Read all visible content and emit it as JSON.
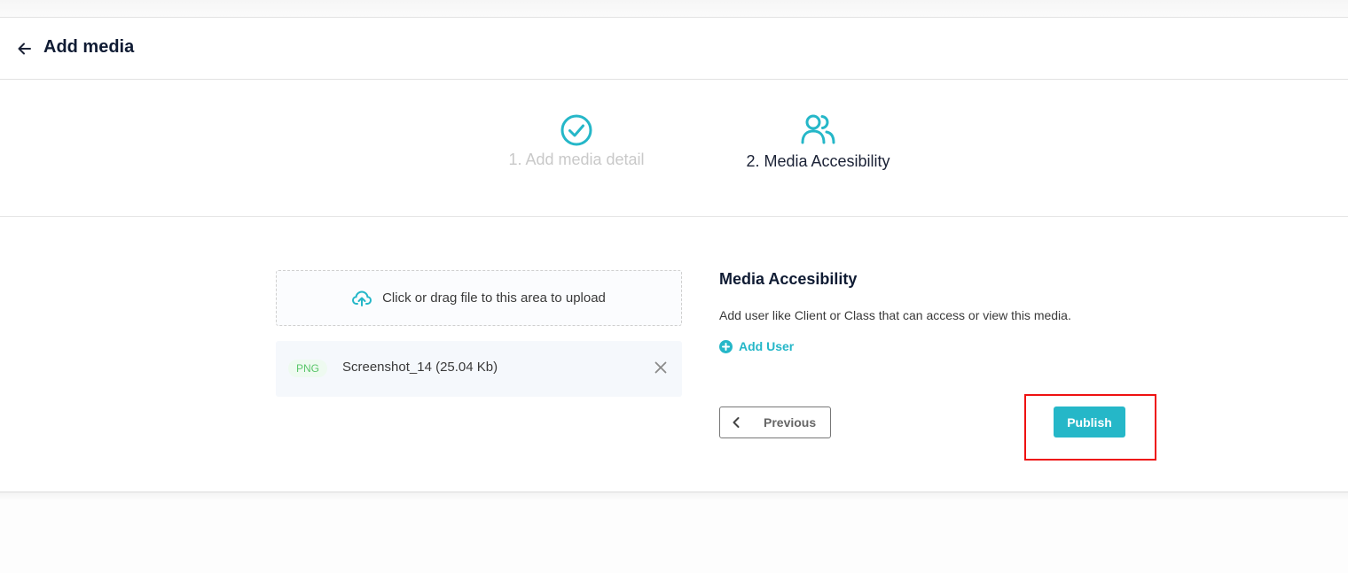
{
  "header": {
    "title": "Add media",
    "back_icon": "arrow-left-icon"
  },
  "steps": [
    {
      "label": "1. Add media detail",
      "icon": "check-circle-icon",
      "state": "completed"
    },
    {
      "label": "2. Media Accesibility",
      "icon": "users-icon",
      "state": "active"
    }
  ],
  "upload": {
    "prompt": "Click or drag file to this area to upload",
    "icon": "cloud-upload-icon"
  },
  "file": {
    "type_badge": "PNG",
    "name": "Screenshot_14 (25.04 Kb)",
    "remove_icon": "close-icon"
  },
  "accessibility": {
    "title": "Media Accesibility",
    "description": "Add user like Client or Class that can access or view this media.",
    "add_user_label": "Add User"
  },
  "actions": {
    "previous_label": "Previous",
    "publish_label": "Publish"
  },
  "colors": {
    "accent": "#25b7c8",
    "highlight": "#ee1111",
    "badge_text": "#5bc66a"
  }
}
